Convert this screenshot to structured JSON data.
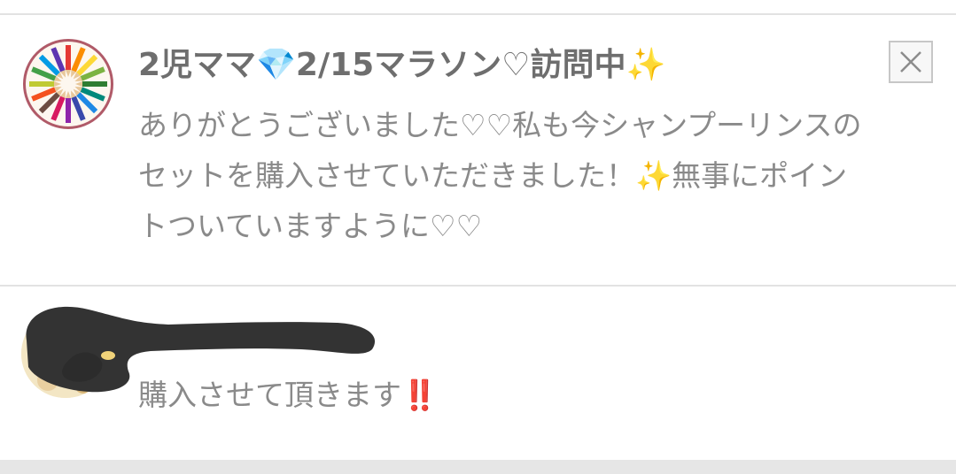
{
  "comments": [
    {
      "author": "2児ママ",
      "author_emoji_gem": "💎",
      "author_rest": "2/15マラソン♡訪問中",
      "author_emoji_sparkle": "✨",
      "body_line1": "ありがとうございました♡♡私も今シャンプーリンスの",
      "body_line2_before": "セットを購入させていただきました！",
      "body_line2_sparkle": "✨",
      "body_line2_after": "無事にポイン",
      "body_line3": "トついていますように♡♡",
      "close_icon": "close-x-icon"
    },
    {
      "body_text": "購入させて頂きます",
      "body_emoji": "‼️"
    }
  ],
  "colors": {
    "text_gray": "#8a8a8a",
    "name_gray": "#6e6e6e",
    "divider": "#e2e2e2",
    "avatar_ring": "#b05a68",
    "sparkle": "#f1cf56",
    "gem": "#5cc3ee",
    "exclaim": "#e0615c"
  }
}
